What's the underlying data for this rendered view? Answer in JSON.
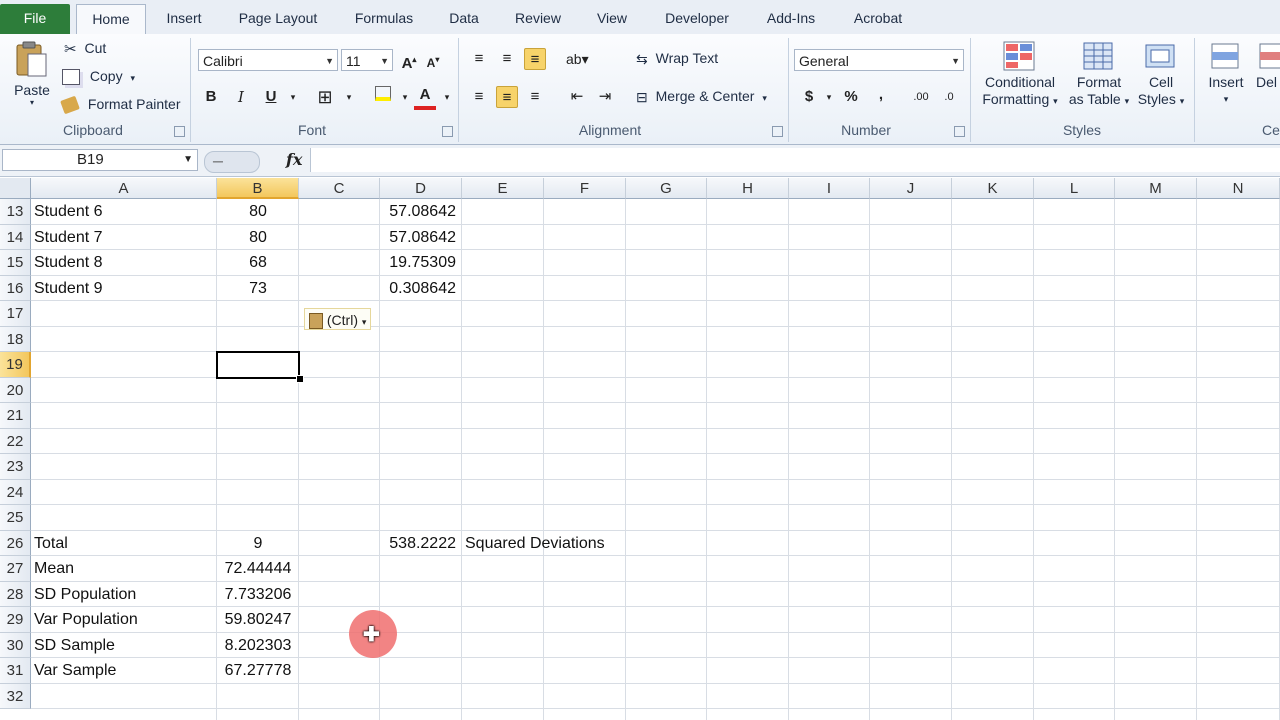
{
  "tabs": {
    "file": "File",
    "home": "Home",
    "insert": "Insert",
    "page_layout": "Page Layout",
    "formulas": "Formulas",
    "data": "Data",
    "review": "Review",
    "view": "View",
    "developer": "Developer",
    "addins": "Add-Ins",
    "acrobat": "Acrobat"
  },
  "clipboard": {
    "paste": "Paste",
    "cut": "Cut",
    "copy": "Copy",
    "format_painter": "Format Painter",
    "label": "Clipboard"
  },
  "font": {
    "name": "Calibri",
    "size": "11",
    "bold": "B",
    "italic": "I",
    "underline": "U",
    "label": "Font"
  },
  "alignment": {
    "wrap_text": "Wrap Text",
    "merge_center": "Merge & Center",
    "label": "Alignment"
  },
  "number": {
    "format": "General",
    "currency": "$",
    "percent": "%",
    "comma": ",",
    "label": "Number"
  },
  "styles": {
    "conditional_1": "Conditional",
    "conditional_2": "Formatting",
    "format_table_1": "Format",
    "format_table_2": "as Table",
    "cell_styles_1": "Cell",
    "cell_styles_2": "Styles",
    "label": "Styles"
  },
  "cells": {
    "insert": "Insert",
    "delete": "Del",
    "label": "Ce"
  },
  "formula_bar": {
    "name_box": "B19",
    "fx": "fx",
    "formula": ""
  },
  "columns": [
    "A",
    "B",
    "C",
    "D",
    "E",
    "F",
    "G",
    "H",
    "I",
    "J",
    "K",
    "L",
    "M",
    "N"
  ],
  "rows": [
    "13",
    "14",
    "15",
    "16",
    "17",
    "18",
    "19",
    "20",
    "21",
    "22",
    "23",
    "24",
    "25",
    "26",
    "27",
    "28",
    "29",
    "30",
    "31",
    "32"
  ],
  "selected_cell": "B19",
  "paste_options": "(Ctrl)",
  "cells_data": [
    {
      "row": "13",
      "A": "Student 6",
      "B": "80",
      "D": "57.08642",
      "E": ""
    },
    {
      "row": "14",
      "A": "Student 7",
      "B": "80",
      "D": "57.08642",
      "E": ""
    },
    {
      "row": "15",
      "A": "Student 8",
      "B": "68",
      "D": "19.75309",
      "E": ""
    },
    {
      "row": "16",
      "A": "Student 9",
      "B": "73",
      "D": "0.308642",
      "E": ""
    },
    {
      "row": "26",
      "A": "Total",
      "B": "9",
      "D": "538.2222",
      "E": "Squared Deviations"
    },
    {
      "row": "27",
      "A": "Mean",
      "B": "72.44444",
      "D": "",
      "E": ""
    },
    {
      "row": "28",
      "A": "SD Population",
      "B": "7.733206",
      "D": "",
      "E": ""
    },
    {
      "row": "29",
      "A": "Var Population",
      "B": "59.80247",
      "D": "",
      "E": ""
    },
    {
      "row": "30",
      "A": "SD Sample",
      "B": "8.202303",
      "D": "",
      "E": ""
    },
    {
      "row": "31",
      "A": "Var Sample",
      "B": "67.27778",
      "D": "",
      "E": ""
    }
  ],
  "colors": {
    "file_tab": "#2d7d3a",
    "selection_header": "#f3c75d",
    "cursor": "#f06e6e"
  }
}
